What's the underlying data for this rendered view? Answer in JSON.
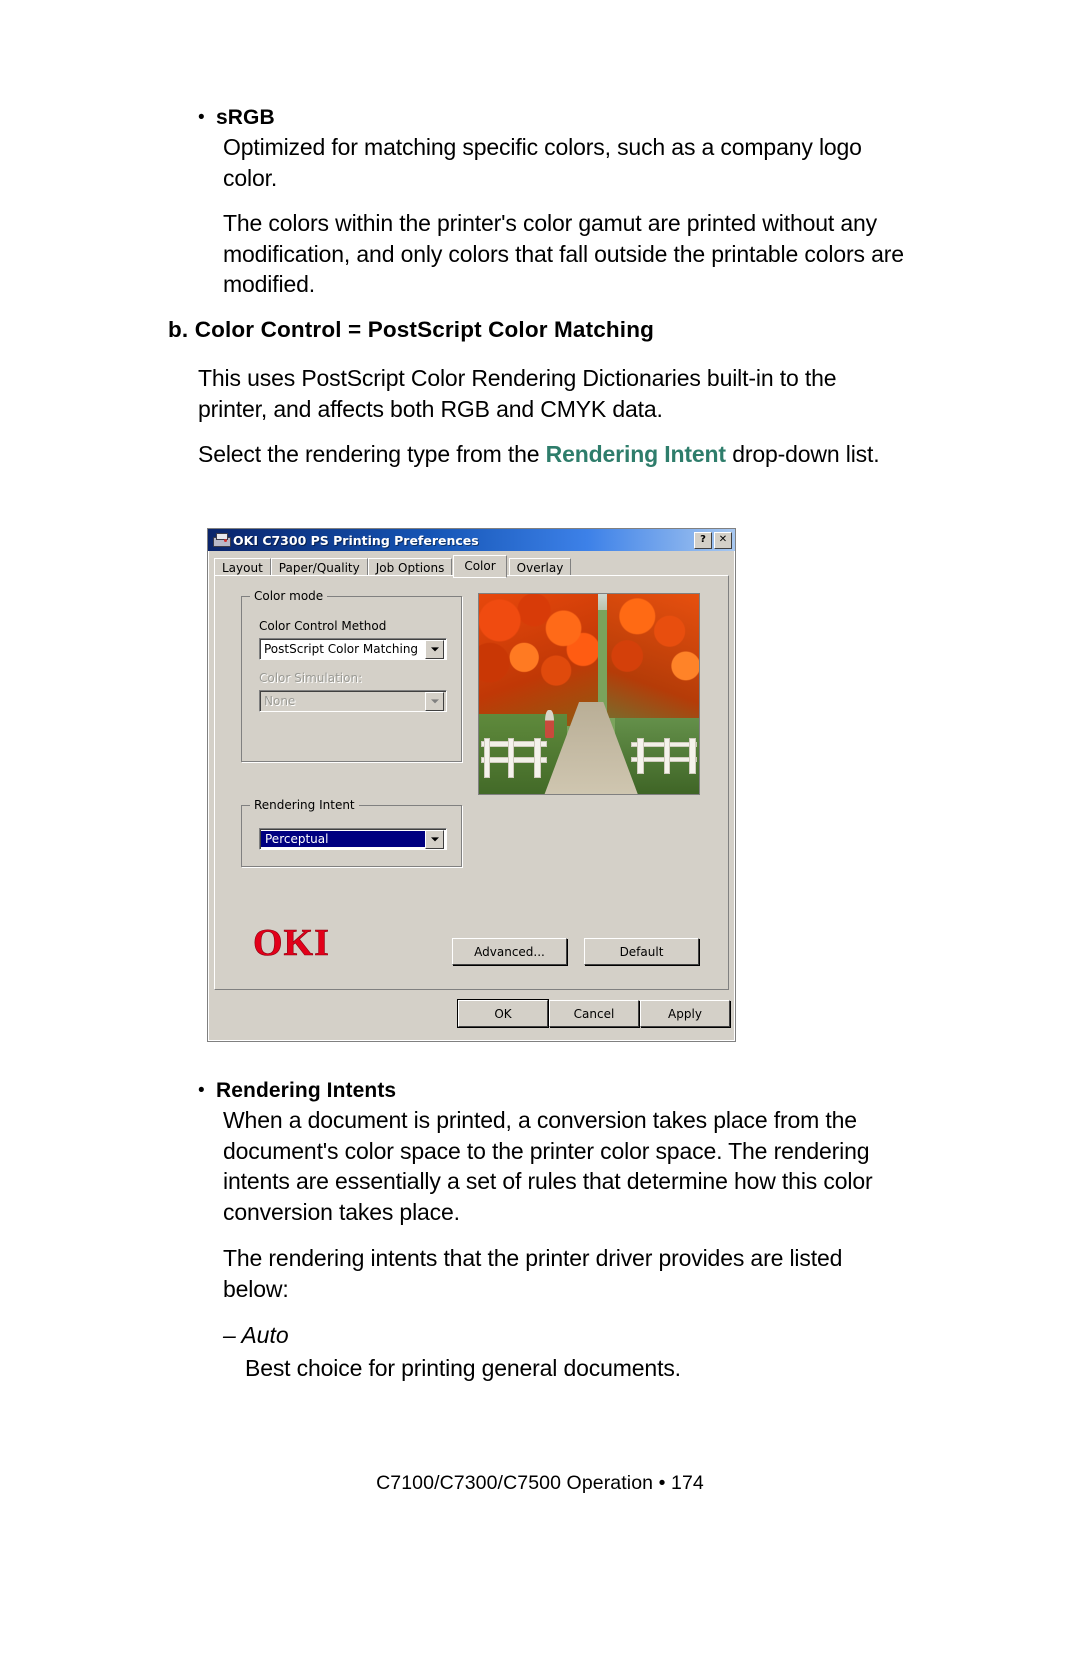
{
  "document": {
    "srgb_bullet": "sRGB",
    "srgb_para1": "Optimized for matching specific colors, such as a company logo color.",
    "srgb_para2": "The colors within the printer's color gamut are printed without any modification, and only colors that fall outside the printable colors are modified.",
    "heading_b": "b. Color Control = PostScript Color Matching",
    "body_para1": "This uses PostScript Color Rendering Dictionaries built-in to the printer, and affects both RGB and CMYK data.",
    "body_para2_pre": "Select the rendering type from the ",
    "body_para2_link": "Rendering Intent",
    "body_para2_post": " drop-down list.",
    "rendering_intents_bullet": "Rendering Intents",
    "rendering_intents_para1": "When a document is printed, a conversion takes place from the document's color space to the printer color space. The rendering intents are essentially a set of rules that determine how this color conversion takes place.",
    "rendering_intents_para2": "The rendering intents that the printer driver provides are listed below:",
    "auto_dash": "– Auto",
    "auto_desc": "Best choice for printing general documents.",
    "footer": "C7100/C7300/C7500 Operation • 174",
    "link_color": "#2e7d6b"
  },
  "dialog": {
    "title": "OKI C7300 PS Printing Preferences",
    "help_button": "?",
    "close_button": "✕",
    "tabs": [
      {
        "label": "Layout",
        "active": false
      },
      {
        "label": "Paper/Quality",
        "active": false
      },
      {
        "label": "Job Options",
        "active": false
      },
      {
        "label": "Color",
        "active": true
      },
      {
        "label": "Overlay",
        "active": false
      }
    ],
    "color_mode": {
      "group_label": "Color mode",
      "control_method_label": "Color Control Method",
      "control_method_value": "PostScript Color Matching",
      "simulation_label": "Color Simulation:",
      "simulation_value": "None",
      "simulation_disabled": true
    },
    "rendering_intent": {
      "group_label": "Rendering Intent",
      "value": "Perceptual",
      "selected": true
    },
    "logo": "OKI",
    "buttons": {
      "advanced": "Advanced...",
      "default": "Default",
      "ok": "OK",
      "cancel": "Cancel",
      "apply": "Apply"
    }
  }
}
